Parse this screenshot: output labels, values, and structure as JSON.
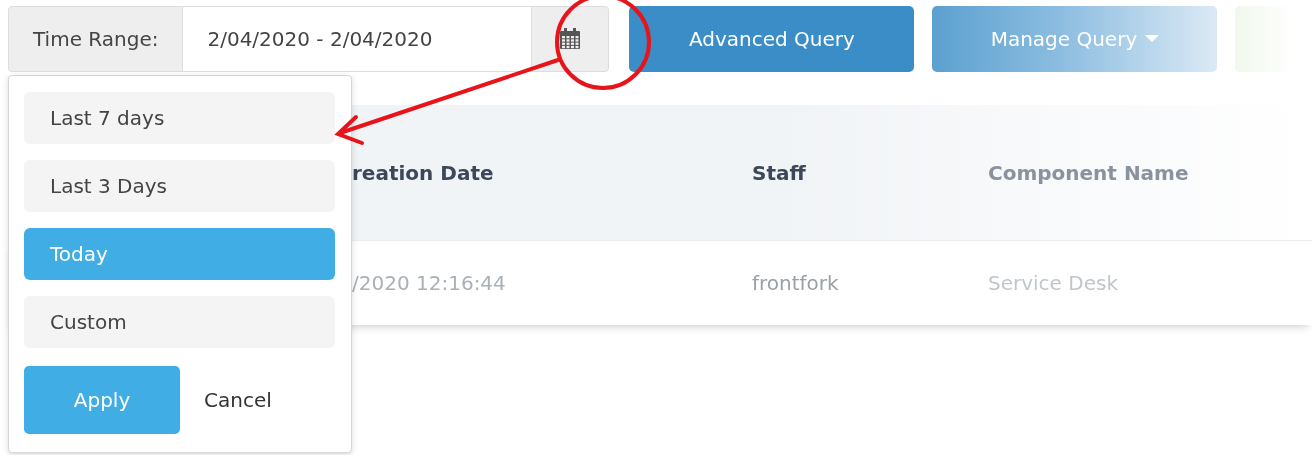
{
  "time_range": {
    "label": "Time Range:",
    "value": "2/04/2020 - 2/04/2020"
  },
  "buttons": [
    {
      "label": "Advanced Query",
      "kind": "primary"
    },
    {
      "label": "Manage Query",
      "kind": "dropdown"
    },
    {
      "kind": "faded"
    }
  ],
  "table": {
    "columns": [
      "reation Date",
      "Staff",
      "Component Name"
    ],
    "rows": [
      [
        "/2020 12:16:44",
        "frontfork",
        "Service Desk"
      ]
    ]
  },
  "range_menu": {
    "options": [
      {
        "label": "Last 7 days",
        "selected": false
      },
      {
        "label": "Last 3 Days",
        "selected": false
      },
      {
        "label": "Today",
        "selected": true
      },
      {
        "label": "Custom",
        "selected": false
      }
    ],
    "apply": "Apply",
    "cancel": "Cancel"
  }
}
